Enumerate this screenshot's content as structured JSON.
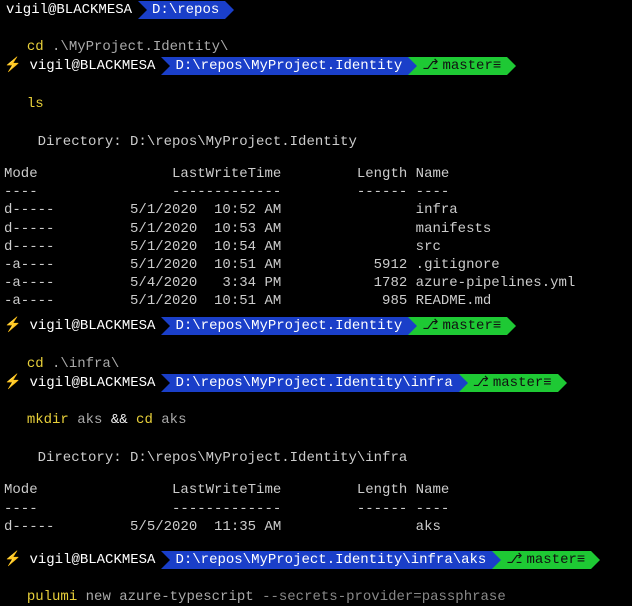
{
  "user": "vigil@BLACKMESA",
  "branch": "master",
  "prompts": {
    "p1": {
      "path": "D:\\repos"
    },
    "p2": {
      "path": "D:\\repos\\MyProject.Identity"
    },
    "p3": {
      "path": "D:\\repos\\MyProject.Identity"
    },
    "p4": {
      "path": "D:\\repos\\MyProject.Identity\\infra"
    },
    "p5": {
      "path": "D:\\repos\\MyProject.Identity\\infra\\aks"
    }
  },
  "cmds": {
    "c1a": "cd",
    "c1b": " .\\MyProject.Identity\\",
    "c2": "ls",
    "c3a": "cd",
    "c3b": " .\\infra\\",
    "c4a": "mkdir",
    "c4b": " aks ",
    "c4c": "&&",
    "c4d": " cd",
    "c4e": " aks",
    "c5a": "pulumi",
    "c5b": " new azure-typescript ",
    "c5c": "--secrets-provider=passphrase"
  },
  "listing1": {
    "dirline": "    Directory: D:\\repos\\MyProject.Identity",
    "header": "Mode                LastWriteTime         Length Name",
    "divider": "----                -------------         ------ ----",
    "rows": [
      "d-----         5/1/2020  10:52 AM                infra",
      "d-----         5/1/2020  10:53 AM                manifests",
      "d-----         5/1/2020  10:54 AM                src",
      "-a----         5/1/2020  10:51 AM           5912 .gitignore",
      "-a----         5/4/2020   3:34 PM           1782 azure-pipelines.yml",
      "-a----         5/1/2020  10:51 AM            985 README.md"
    ]
  },
  "listing2": {
    "dirline": "    Directory: D:\\repos\\MyProject.Identity\\infra",
    "header": "Mode                LastWriteTime         Length Name",
    "divider": "----                -------------         ------ ----",
    "rows": [
      "d-----         5/5/2020  11:35 AM                aks"
    ]
  }
}
